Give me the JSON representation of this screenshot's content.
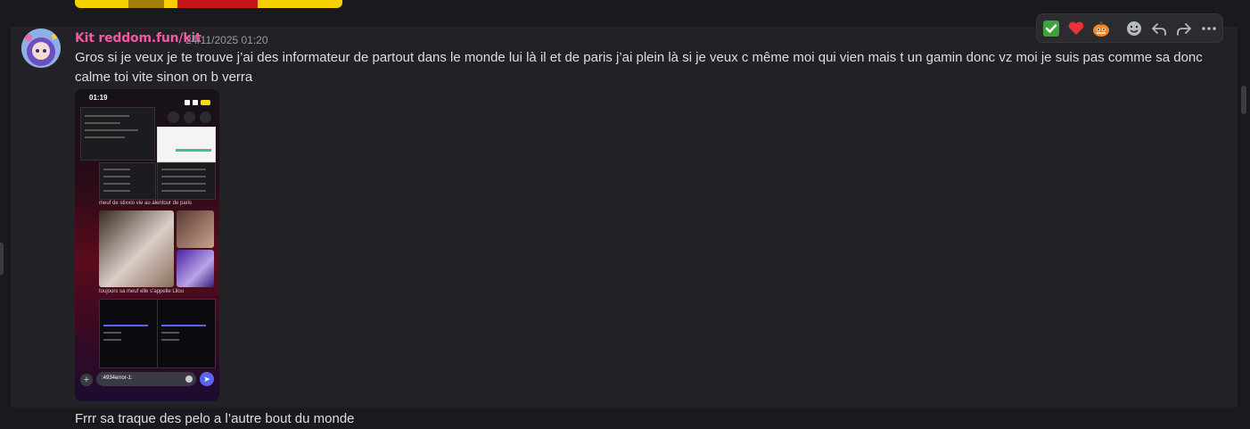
{
  "message": {
    "username": "Kit reddom.fun/kit",
    "timestamp": "24/11/2025 01:20",
    "text": "Gros si je veux je te trouve j’ai des informateur de partout dans le monde lui là il et de paris j’ai plein là si je veux c même moi qui vien mais t un gamin donc vz moi je suis pas comme sa donc calme toi vite sinon on b verra",
    "attachment": {
      "phone_time": "01:19",
      "caption_1": "meuf de stixxio vie au alentour de paris",
      "caption_2": "toujours sa meuf elle s’appelle Lilou",
      "input_value": ":4934error-1:"
    }
  },
  "next_message": {
    "text": "Frrr sa traque des pelo a l’autre bout du monde"
  },
  "toolbar": {
    "reactions": [
      "white-check-mark",
      "heart",
      "pumpkin-ghost"
    ],
    "actions": [
      "add-reaction",
      "reply",
      "forward",
      "more"
    ]
  },
  "colors": {
    "username": "#f05aa0",
    "background": "#1a1a1e",
    "hover_row": "#222226"
  }
}
